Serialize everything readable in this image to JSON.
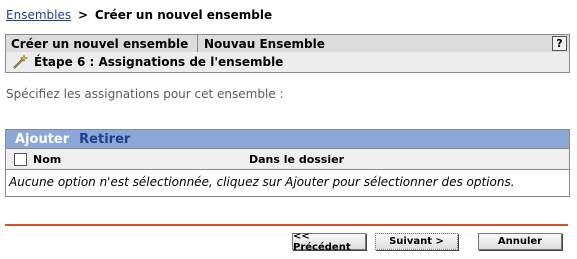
{
  "breadcrumb": {
    "parent": "Ensembles",
    "separator": ">",
    "current": "Créer un nouvel ensemble"
  },
  "wizard": {
    "title": "Créer un nouvel ensemble",
    "bundle_name": "Nouvau Ensemble",
    "help_label": "?",
    "step_label": "Étape 6 : Assignations de l'ensemble",
    "step_icon": "wand-icon"
  },
  "instruction": "Spécifiez les assignations pour cet ensemble :",
  "assignments": {
    "toolbar": {
      "add_label": "Ajouter",
      "remove_label": "Retirer"
    },
    "columns": {
      "name": "Nom",
      "folder": "Dans le dossier"
    },
    "empty_message": "Aucune option n'est sélectionnée, cliquez sur Ajouter pour sélectionner des options."
  },
  "buttons": {
    "previous": "<< Précédent",
    "next": "Suivant >",
    "cancel": "Annuler"
  },
  "colors": {
    "toolbar_bg": "#8aa7d6",
    "link": "#1f3f8f",
    "divider": "#d0552a"
  }
}
